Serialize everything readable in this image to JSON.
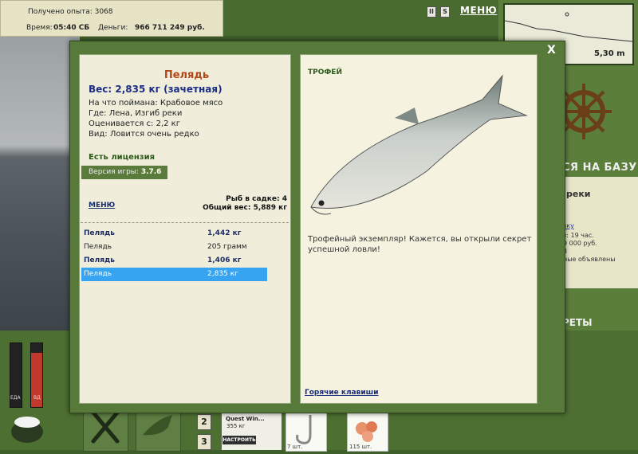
{
  "stats": {
    "exp_label": "Получено опыта: 3068",
    "time_label": "Время:",
    "time_value": "05:40 СБ",
    "money_label": "Деньги:",
    "money_value": "966 711 249 руб."
  },
  "top": {
    "pause_glyph": "II",
    "sound_glyph": "S",
    "menu_label": "МЕНЮ"
  },
  "minimap": {
    "depth": "5,30 m"
  },
  "right_panel": {
    "base_label": "СЯ НА БАЗУ",
    "info_title": "реки",
    "info_lines": [
      "зку",
      "з: 19 час.",
      "9 000 руб.",
      "3",
      "ные объявлены"
    ],
    "secrets_label": "РЕТЫ"
  },
  "bottom": {
    "food_label": "ЕДА",
    "drink_label": "ВД",
    "num_2": "2",
    "num_3": "3",
    "quest_title": "Quest Win...",
    "quest_weight": "355 кг",
    "quest_button": "НАСТРОИТЬ",
    "item1_count": "7 шт.",
    "item2_count": "115 шт."
  },
  "modal": {
    "close": "X",
    "fish_name": "Пелядь",
    "weight": "Вес: 2,835 кг (зачетная)",
    "caught_on": "На что поймана: Крабовое мясо",
    "where": "Где: Лена, Изгиб реки",
    "valued": "Оценивается с: 2,2 кг",
    "kind": "Вид: Ловится очень редко",
    "license": "Есть лицензия",
    "version_label": "Версия игры:",
    "version_value": "3.7.6",
    "menu_link": "МЕНЮ",
    "keep_count": "Рыб в садке: 4",
    "keep_weight": "Общий вес: 5,889 кг",
    "catches": [
      {
        "name": "Пелядь",
        "weight": "1,442 кг",
        "style": "bold"
      },
      {
        "name": "Пелядь",
        "weight": "205 грамм",
        "style": "plain"
      },
      {
        "name": "Пелядь",
        "weight": "1,406 кг",
        "style": "bold"
      },
      {
        "name": "Пелядь",
        "weight": "2,835 кг",
        "style": "sel"
      }
    ],
    "trophy_title": "ТРОФЕЙ",
    "trophy_text": "Трофейный экземпляр! Кажется, вы открыли секрет успешной ловли!",
    "hotkeys": "Горячие клавиши"
  },
  "colors": {
    "accent_green": "#57793a",
    "panel_bg": "#f0eedb",
    "selected_row": "#36a4f0",
    "fish_name": "#b44718",
    "weight_blue": "#1d2d86"
  }
}
